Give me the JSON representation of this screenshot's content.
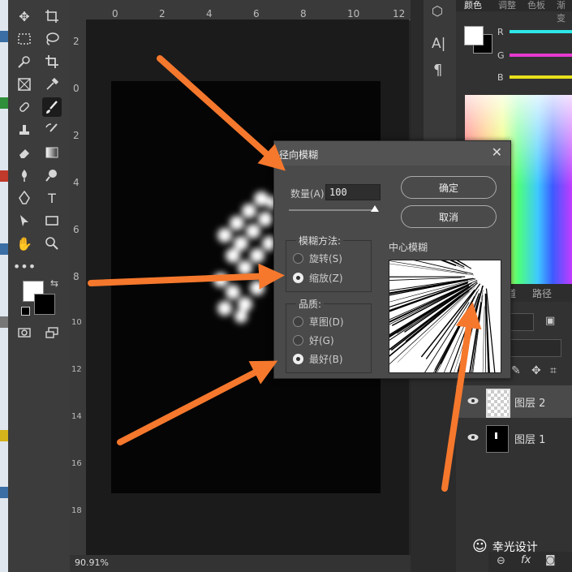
{
  "status": {
    "zoom": "90.91%"
  },
  "rulers": {
    "top": [
      "0",
      "2",
      "4",
      "6",
      "8",
      "10",
      "12"
    ],
    "left": [
      "2",
      "0",
      "2",
      "4",
      "6",
      "8",
      "10",
      "12",
      "14",
      "16",
      "18"
    ]
  },
  "panel_tabs": [
    "颜色",
    "调整",
    "色板",
    "渐变"
  ],
  "color_sliders": [
    {
      "label": "R",
      "color": "#2ee6e6"
    },
    {
      "label": "G",
      "color": "#e63ad0"
    },
    {
      "label": "B",
      "color": "#e6e01c"
    }
  ],
  "layers_tabs": {
    "tab1": "道",
    "tab2": "路径"
  },
  "layers": [
    {
      "name": "图层 2"
    },
    {
      "name": "图层 1"
    }
  ],
  "dialog": {
    "title": "径向模糊",
    "close": "✕",
    "amount_label": "数量(A)",
    "amount_value": "100",
    "amount_max": 100,
    "ok_label": "确定",
    "cancel_label": "取消",
    "method_title": "模糊方法:",
    "method_options": [
      "旋转(S)",
      "缩放(Z)"
    ],
    "method_selected": "缩放(Z)",
    "quality_title": "品质:",
    "quality_options": [
      "草图(D)",
      "好(G)",
      "最好(B)"
    ],
    "quality_selected": "最好(B)",
    "center_label": "中心模糊"
  },
  "side_panel": {
    "char_icon": "A|",
    "para_icon": "¶"
  },
  "watermark": {
    "text": "幸光设计"
  },
  "colors": {
    "arrow": "#f5782d",
    "swatch_fg": "#ffffff",
    "swatch_bg": "#000000"
  }
}
